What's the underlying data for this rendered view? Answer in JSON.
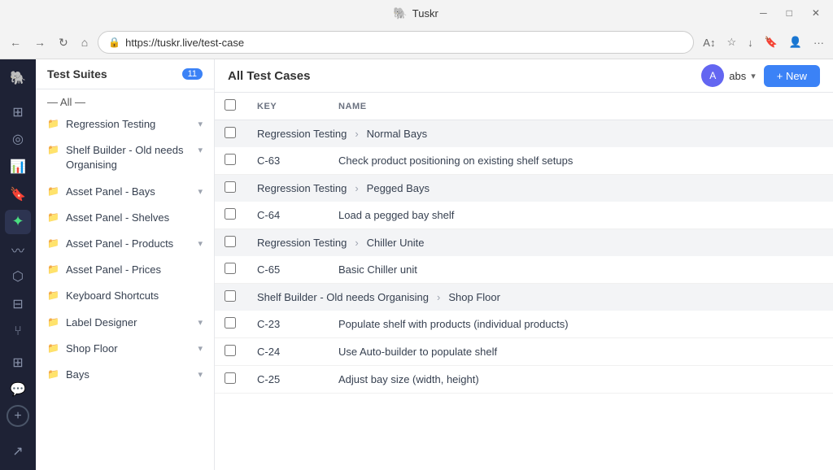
{
  "browser": {
    "title": "Tuskr",
    "url": "https://tuskr.live/test-case",
    "window_controls": [
      "minimize",
      "maximize",
      "close"
    ]
  },
  "header": {
    "user": {
      "initials": "A",
      "name": "abs"
    },
    "new_button": "+ New"
  },
  "suites_panel": {
    "title": "Test Suites",
    "badge": "11",
    "all_filter": "— All —",
    "items": [
      {
        "label": "Regression Testing",
        "has_children": true
      },
      {
        "label": "Shelf Builder - Old needs Organising",
        "has_children": true
      },
      {
        "label": "Asset Panel - Bays",
        "has_children": true
      },
      {
        "label": "Asset Panel - Shelves",
        "has_children": false
      },
      {
        "label": "Asset Panel - Products",
        "has_children": true
      },
      {
        "label": "Asset Panel - Prices",
        "has_children": false
      },
      {
        "label": "Keyboard Shortcuts",
        "has_children": false
      },
      {
        "label": "Label Designer",
        "has_children": true
      },
      {
        "label": "Shop Floor",
        "has_children": true
      },
      {
        "label": "Bays",
        "has_children": true
      }
    ]
  },
  "main": {
    "title": "All Test Cases",
    "columns": {
      "key": "KEY",
      "name": "NAME"
    },
    "rows": [
      {
        "type": "group",
        "breadcrumb": [
          "Regression Testing",
          "Normal Bays"
        ]
      },
      {
        "type": "data",
        "key": "C-63",
        "name": "Check product positioning on existing shelf setups"
      },
      {
        "type": "group",
        "breadcrumb": [
          "Regression Testing",
          "Pegged Bays"
        ]
      },
      {
        "type": "data",
        "key": "C-64",
        "name": "Load a pegged bay shelf"
      },
      {
        "type": "group",
        "breadcrumb": [
          "Regression Testing",
          "Chiller Unite"
        ]
      },
      {
        "type": "data",
        "key": "C-65",
        "name": "Basic Chiller unit"
      },
      {
        "type": "group",
        "breadcrumb": [
          "Shelf Builder - Old needs Organising",
          "Shop Floor"
        ]
      },
      {
        "type": "data",
        "key": "C-23",
        "name": "Populate shelf with products (individual products)"
      },
      {
        "type": "data",
        "key": "C-24",
        "name": "Use Auto-builder to populate shelf"
      },
      {
        "type": "data",
        "key": "C-25",
        "name": "Adjust bay size (width, height)"
      }
    ]
  },
  "icons": {
    "elephant": "🐘",
    "back": "←",
    "forward": "→",
    "refresh": "↻",
    "home": "⌂",
    "lock": "🔒",
    "folder": "📁",
    "chevron_down": "▾",
    "chevron_right": "›",
    "minimize": "─",
    "maximize": "□",
    "close": "✕",
    "more": "···",
    "plus": "+"
  },
  "sidebar_icons": [
    {
      "name": "brand-icon",
      "symbol": "🐘",
      "active": false
    },
    {
      "name": "dashboard-icon",
      "symbol": "⊞",
      "active": false
    },
    {
      "name": "analytics-icon",
      "symbol": "📊",
      "active": false
    },
    {
      "name": "chart-icon",
      "symbol": "📈",
      "active": false
    },
    {
      "name": "test-icon",
      "symbol": "✦",
      "active": true
    },
    {
      "name": "trends-icon",
      "symbol": "〰",
      "active": false
    },
    {
      "name": "shapes-icon",
      "symbol": "⬡",
      "active": false
    },
    {
      "name": "table-icon",
      "symbol": "⊟",
      "active": false
    },
    {
      "name": "git-icon",
      "symbol": "⑂",
      "active": false
    },
    {
      "name": "filter-icon",
      "symbol": "⊞",
      "active": false
    },
    {
      "name": "chat-icon",
      "symbol": "💬",
      "active": false
    }
  ]
}
